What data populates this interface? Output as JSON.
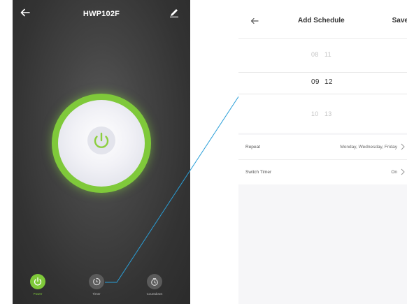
{
  "left": {
    "title": "HWP102F",
    "tabs": [
      {
        "label": "Power"
      },
      {
        "label": "Timer"
      },
      {
        "label": "Countdown"
      }
    ]
  },
  "right": {
    "title": "Add Schedule",
    "save_label": "Save",
    "time_picker": {
      "rows": [
        {
          "hour": "08",
          "minute": "11"
        },
        {
          "hour": "09",
          "minute": "12"
        },
        {
          "hour": "10",
          "minute": "13"
        }
      ],
      "selected_index": 1
    },
    "settings": [
      {
        "label": "Repeat",
        "value": "Monday, Wednesday, Friday"
      },
      {
        "label": "Switch Timer",
        "value": "On"
      }
    ]
  },
  "colors": {
    "accent_green": "#7fc93a",
    "connector_blue": "#2a9fd8"
  }
}
